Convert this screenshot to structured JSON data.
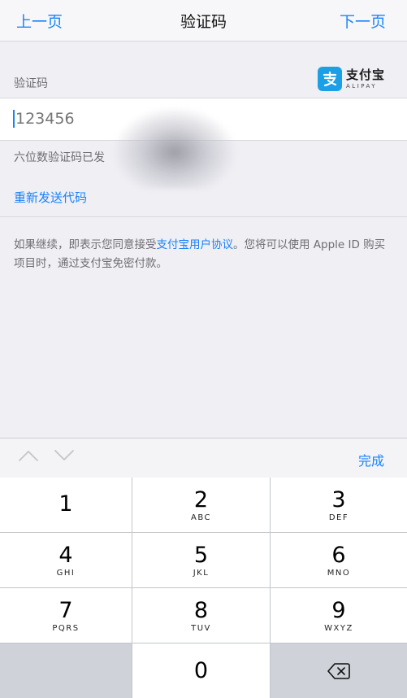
{
  "nav": {
    "prev_label": "上一页",
    "title": "验证码",
    "next_label": "下一页"
  },
  "form": {
    "section_label": "验证码",
    "code_value": "123456",
    "hint": "六位数验证码已发",
    "resend_label": "重新发送代码"
  },
  "brand": {
    "name_cn": "支付宝",
    "name_en": "ALIPAY",
    "color": "#1ba0e6",
    "icon": "alipay-logo-icon"
  },
  "terms": {
    "prefix": "如果继续，即表示您同意接受",
    "link": "支付宝用户协议",
    "suffix": "。您将可以使用 Apple ID 购买项目时，通过支付宝免密付款。"
  },
  "keyboard": {
    "done_label": "完成",
    "keys": [
      {
        "num": "1",
        "letters": ""
      },
      {
        "num": "2",
        "letters": "ABC"
      },
      {
        "num": "3",
        "letters": "DEF"
      },
      {
        "num": "4",
        "letters": "GHI"
      },
      {
        "num": "5",
        "letters": "JKL"
      },
      {
        "num": "6",
        "letters": "MNO"
      },
      {
        "num": "7",
        "letters": "PQRS"
      },
      {
        "num": "8",
        "letters": "TUV"
      },
      {
        "num": "9",
        "letters": "WXYZ"
      },
      {
        "num": "0",
        "letters": ""
      }
    ],
    "delete_icon": "backspace-icon"
  },
  "colors": {
    "accent": "#1a82fb",
    "background": "#efeff4",
    "keypad_gray": "#cfd3d9"
  }
}
